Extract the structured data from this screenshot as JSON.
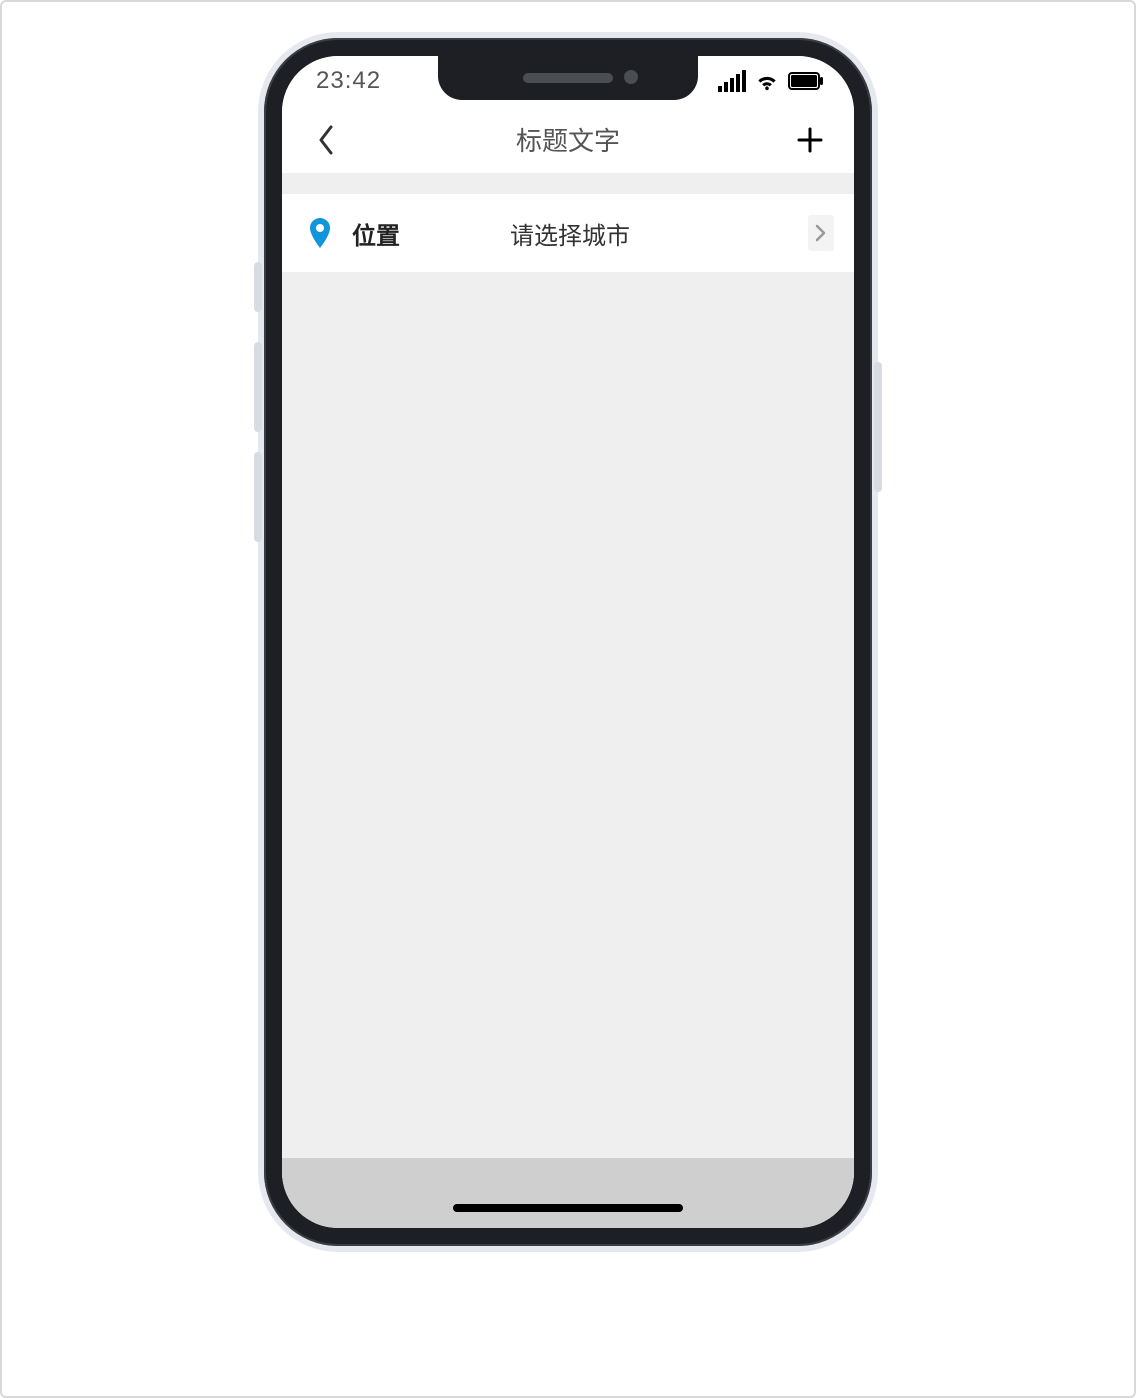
{
  "statusbar": {
    "time": "23:42"
  },
  "nav": {
    "title": "标题文字"
  },
  "row": {
    "label": "位置",
    "value": "请选择城市"
  },
  "colors": {
    "accent": "#1296db"
  }
}
